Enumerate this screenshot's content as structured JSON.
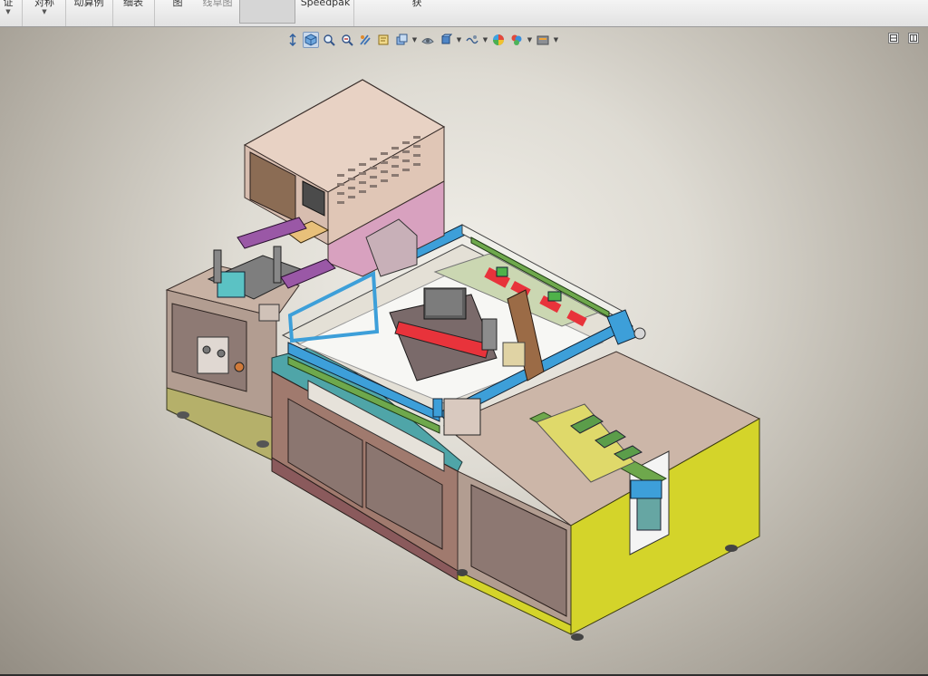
{
  "ribbon": {
    "items": [
      {
        "label": "证",
        "has_dropdown": true
      },
      {
        "label": "对称",
        "has_dropdown": true
      },
      {
        "label": "动算例"
      },
      {
        "label": "细表"
      },
      {
        "label": "图"
      },
      {
        "label": "线草图"
      },
      {
        "label": "Speedpak"
      },
      {
        "label": "获"
      }
    ]
  },
  "view_toolbar": {
    "tools": [
      "zoom-to-fit-icon",
      "view-orientation-cube-icon",
      "zoom-to-area-icon",
      "previous-view-icon",
      "section-view-icon",
      "dynamic-annotation-icon",
      "display-style-icon",
      "hide-show-items-icon",
      "edit-appearance-icon",
      "apply-scene-icon",
      "view-settings-icon",
      "render-tools-icon",
      "hud-options-icon"
    ]
  },
  "window_controls": [
    "tile-horizontal-icon",
    "tile-vertical-icon"
  ],
  "colors": {
    "cabinet": "#c6b0a3",
    "cabinet_door": "#8d7872",
    "yellow_side": "#d4d42a",
    "blue_rail": "#3d9fd9",
    "green_rail": "#6ea84c",
    "hood": "#e2c7b6",
    "hood_lower": "#d8a1bf",
    "red_parts": "#e8333b"
  }
}
